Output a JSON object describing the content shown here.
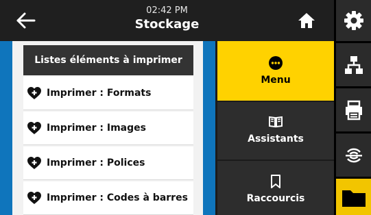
{
  "header": {
    "time": "02:42 PM",
    "title": "Stockage"
  },
  "list": {
    "heading": "Listes éléments à imprimer",
    "items": [
      {
        "label": "Imprimer : Formats"
      },
      {
        "label": "Imprimer : Images"
      },
      {
        "label": "Imprimer : Polices"
      },
      {
        "label": "Imprimer : Codes à barres"
      }
    ]
  },
  "menu": {
    "items": [
      {
        "label": "Menu",
        "icon": "dots-menu-icon",
        "active": true
      },
      {
        "label": "Assistants",
        "icon": "book-icon",
        "active": false
      },
      {
        "label": "Raccourcis",
        "icon": "bookmark-icon",
        "active": false
      }
    ]
  },
  "sidebar": {
    "items": [
      {
        "icon": "gear-icon",
        "active": false
      },
      {
        "icon": "network-icon",
        "active": false
      },
      {
        "icon": "printer-icon",
        "active": false
      },
      {
        "icon": "wireless-sensor-icon",
        "active": false
      },
      {
        "icon": "folder-icon",
        "active": true
      }
    ]
  },
  "colors": {
    "accent": "#ffd200",
    "panel_blue": "#0f75bc",
    "header": "#1f1f1f"
  }
}
